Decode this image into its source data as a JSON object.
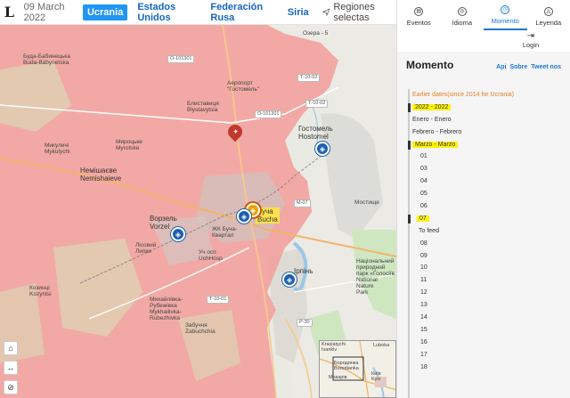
{
  "topbar": {
    "logo": "L",
    "date": "09 March 2022",
    "tabs": [
      {
        "label": "Ucrania",
        "active": true
      },
      {
        "label": "Estados Unidos",
        "active": false
      },
      {
        "label": "Federación Rusa",
        "active": false
      },
      {
        "label": "Siria",
        "active": false
      }
    ],
    "regions_label": "Regiones selectas"
  },
  "map": {
    "labels": {
      "ozera": "Озера - 5",
      "buda": "Буда-Бабинецька\nBuda-Babynetska",
      "blystavytsia": "Блиставиця\nBlystavytsia",
      "airport": "Аеропорт\n\"Гостомель\"",
      "hostomel": "Гостомель\nHostomel",
      "myrotske": "Мироцьке\nMyrotske",
      "mykulychi": "Микуличі\nMykulychi",
      "nemishaeve": "Немішаєве\nNemishaieve",
      "vorzel": "Ворзель\nVorzel",
      "bucha": "Буча\nBucha",
      "bucha_hosp": "ЖК Буча-\nКвартал",
      "uch_hosp": "Уч осп\nUchHosp",
      "lypky": "Лісовий\nЛипки",
      "kozyntsi": "Козинці\nKozyntsi",
      "mykhailivka": "Михайлівка-\nРубежівка\nMykhailivka-\nRubezhivka",
      "zabuchchia": "Забуччя\nZabuchchia",
      "mostyshche": "Мостище",
      "irpin": "Ірпінь",
      "park": "Національний\nприродний\nпарк «Голосіїв.\nNational\nNature\nPark"
    },
    "roads": [
      "О-101301",
      "Т-10-02",
      "О-101301",
      "Т-10-02",
      "М-07",
      "Т-10-01",
      "Р-30"
    ],
    "minimap_labels": {
      "krasiatychi": "Krasiatychi\nIvankiv",
      "borodianka": "Бородянка\nBorodianka",
      "makariv": "Макарів",
      "kyiv": "Київ\nKyiv"
    },
    "minimap_road": "Luboka"
  },
  "panel": {
    "tabs": [
      {
        "label": "Eventos",
        "icon": "eventos-icon"
      },
      {
        "label": "Idioma",
        "icon": "globe-icon"
      },
      {
        "label": "Momento",
        "icon": "clock-icon",
        "active": true
      },
      {
        "label": "Leyenda",
        "icon": "compass-icon"
      }
    ],
    "login": "Login",
    "title": "Momento",
    "links": [
      "Api",
      "Sobre",
      "Tweet nos"
    ],
    "timeline": {
      "earlier": "Earlier dates(since 2014 for Ucrania)",
      "year": "2022 - 2022",
      "months": [
        "Enero - Enero",
        "Febrero - Febrero",
        "Marzo - Marzo"
      ],
      "days_before": [
        "01",
        "03",
        "04",
        "05",
        "06"
      ],
      "selected_day": "07",
      "to_feed": "To feed",
      "days_after": [
        "08",
        "09",
        "10",
        "11",
        "12",
        "13",
        "14",
        "15",
        "16",
        "17",
        "18",
        "19"
      ]
    }
  },
  "colors": {
    "accent": "#2196f3",
    "occupied": "#f08e8e",
    "highlight": "#fff200",
    "timeline_orange": "#e67e22"
  }
}
